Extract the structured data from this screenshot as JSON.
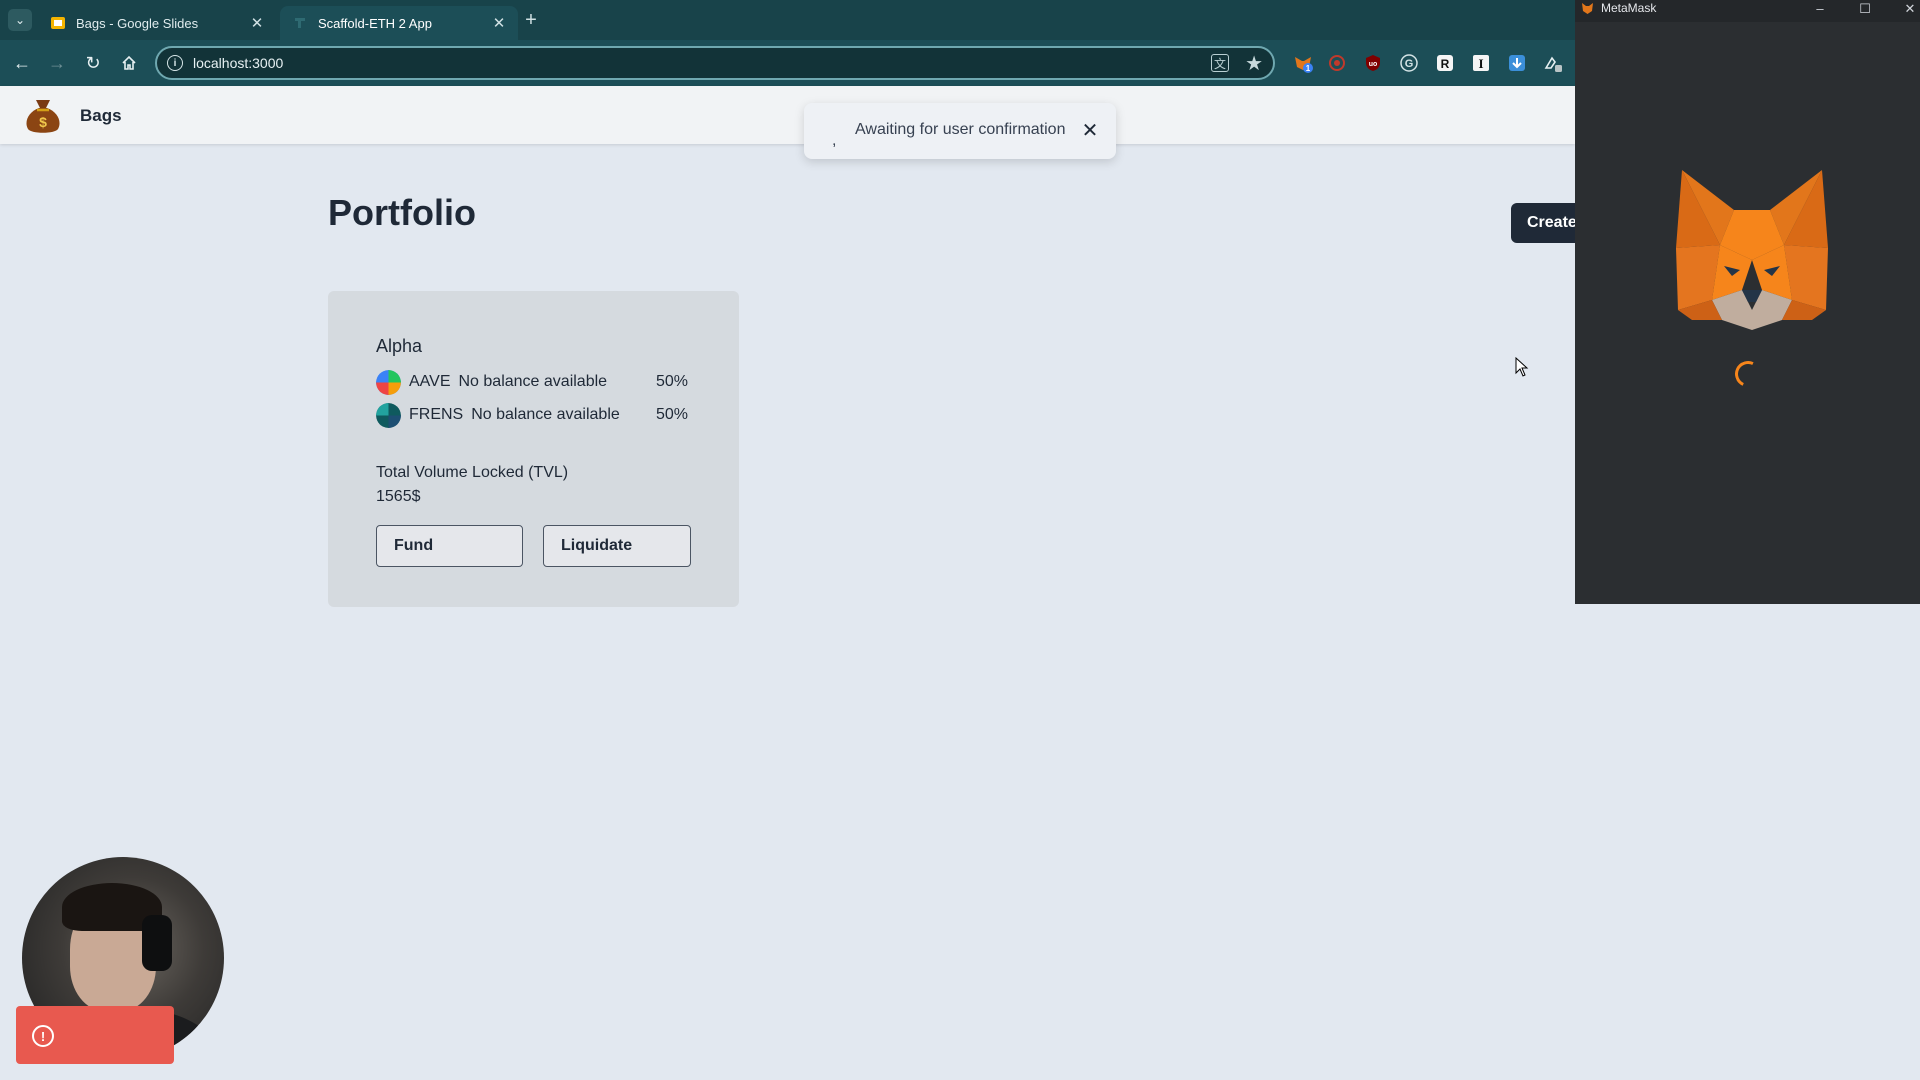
{
  "browser": {
    "tabs": [
      {
        "title": "Bags - Google Slides",
        "active": false,
        "favicon": "google-slides-icon"
      },
      {
        "title": "Scaffold-ETH 2 App",
        "active": true,
        "favicon": "scaffold-eth-icon"
      }
    ],
    "address": "localhost:3000",
    "extensions": [
      {
        "name": "metamask-extension-icon",
        "badge": "1"
      },
      {
        "name": "record-extension-icon"
      },
      {
        "name": "ublock-extension-icon",
        "label": "uo"
      },
      {
        "name": "grammarly-extension-icon",
        "label": "G"
      },
      {
        "name": "readwise-extension-icon",
        "label": "R"
      },
      {
        "name": "instapaper-extension-icon",
        "label": "I"
      },
      {
        "name": "download-extension-icon"
      },
      {
        "name": "puzzle-extension-icon"
      }
    ]
  },
  "app": {
    "name": "Bags",
    "page_title": "Portfolio",
    "create_label": "Create",
    "toast": {
      "message": "Awaiting for user confirmation",
      "spinner": ","
    },
    "portfolio": {
      "name": "Alpha",
      "assets": [
        {
          "symbol": "AAVE",
          "balance": "No balance available",
          "weight": "50%"
        },
        {
          "symbol": "FRENS",
          "balance": "No balance available",
          "weight": "50%"
        }
      ],
      "tvl_label": "Total Volume Locked (TVL)",
      "tvl_value": "1565$",
      "fund_label": "Fund",
      "liquidate_label": "Liquidate"
    }
  },
  "metamask": {
    "window_title": "MetaMask",
    "status": "loading"
  },
  "colors": {
    "accent": "#f6851b",
    "chrome_bg": "#1c4e57",
    "page_bg": "#e2e8f0",
    "alert": "#e8594f"
  }
}
